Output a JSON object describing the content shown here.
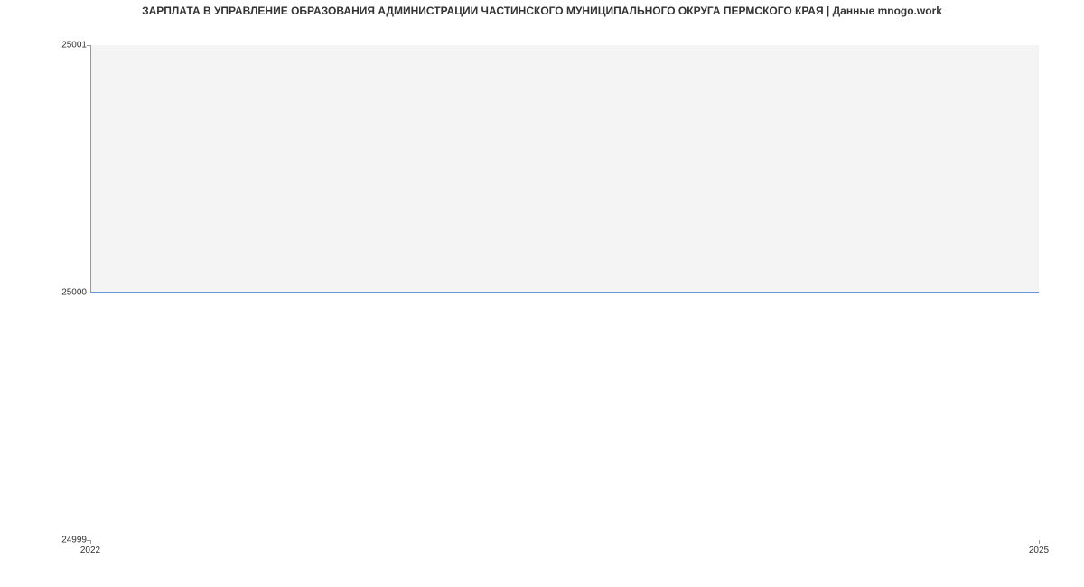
{
  "chart_data": {
    "type": "line",
    "title": "ЗАРПЛАТА В УПРАВЛЕНИЕ ОБРАЗОВАНИЯ АДМИНИСТРАЦИИ ЧАСТИНСКОГО МУНИЦИПАЛЬНОГО ОКРУГА ПЕРМСКОГО КРАЯ | Данные mnogo.work",
    "x": [
      2022,
      2025
    ],
    "values": [
      25000,
      25000
    ],
    "xlabel": "",
    "ylabel": "",
    "xlim": [
      2022,
      2025
    ],
    "ylim": [
      24999,
      25001
    ],
    "x_ticks": [
      "2022",
      "2025"
    ],
    "y_ticks": [
      "24999",
      "25000",
      "25001"
    ]
  }
}
